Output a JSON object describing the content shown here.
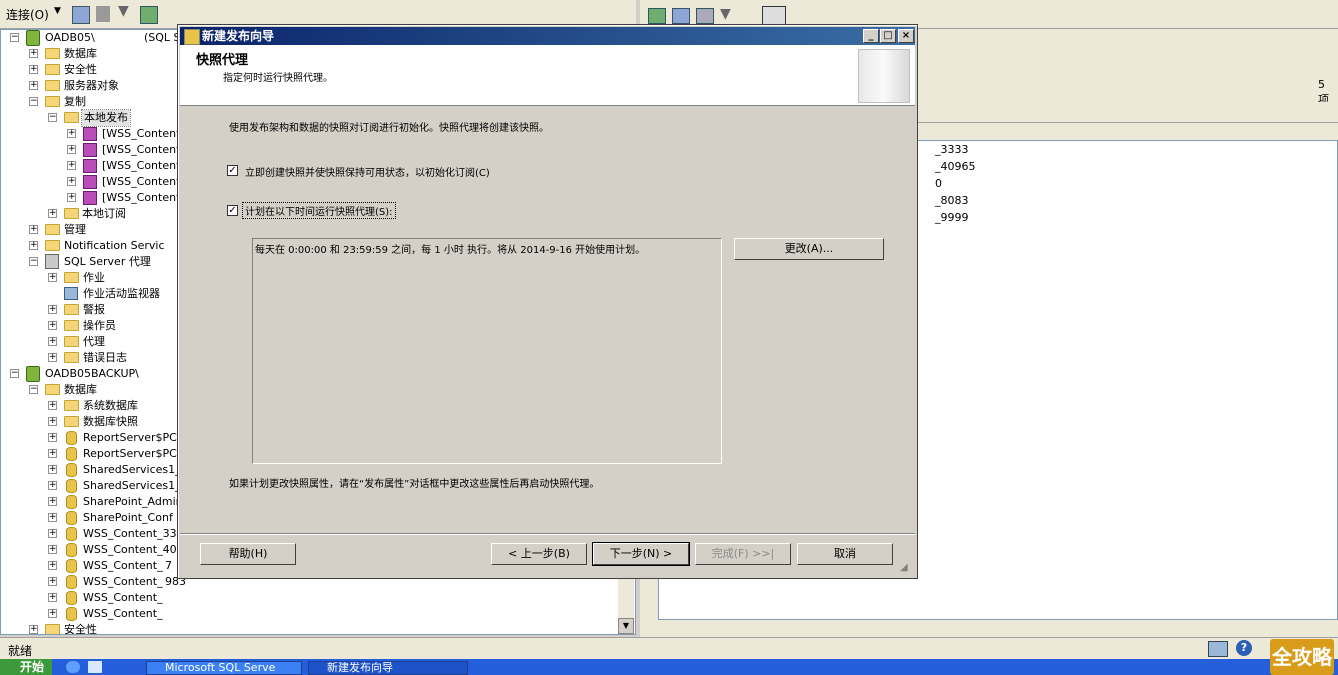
{
  "toolbar": {
    "connect_label": "连接(O)"
  },
  "explorer": {
    "servers": [
      {
        "name": "OADB05\\",
        "suffix": "(SQL S"
      },
      {
        "name": "OADB05BACKUP\\"
      }
    ],
    "nodes": {
      "databases": "数据库",
      "security": "安全性",
      "server_objects": "服务器对象",
      "replication": "复制",
      "local_publications": "本地发布",
      "publications": [
        "[WSS_Content",
        "[WSS_Content",
        "[WSS_Content",
        "[WSS_Content",
        "[WSS_Content"
      ],
      "local_subscriptions": "本地订阅",
      "management": "管理",
      "notification": "Notification Servic",
      "agent": "SQL Server 代理",
      "jobs": "作业",
      "job_monitor": "作业活动监视器",
      "alerts": "警报",
      "operators": "操作员",
      "proxies": "代理",
      "error_logs": "错误日志",
      "databases2": "数据库",
      "system_db": "系统数据库",
      "db_snapshots": "数据库快照",
      "dbs": [
        "ReportServer$PC1",
        "ReportServer$PC1",
        "SharedServices1_",
        "SharedServices1_",
        "SharePoint_Admin",
        "SharePoint_Conf",
        "WSS_Content_3333",
        "WSS_Content_4096",
        "WSS_Content_",
        "WSS_Content_",
        "WSS_Content_",
        "WSS_Content_"
      ],
      "db_extra": [
        "",
        "",
        "",
        "",
        "",
        "",
        "",
        "",
        "7",
        "983",
        "",
        ""
      ],
      "security2": "安全性"
    }
  },
  "rightpane": {
    "count_text": "5 项",
    "items": [
      "_3333",
      "_40965",
      "0",
      "_8083",
      "_9999"
    ]
  },
  "status": {
    "text": "就绪"
  },
  "taskbar": {
    "start": "开始",
    "tasks": [
      "Microsoft SQL Serve",
      "新建发布向导"
    ],
    "watermark": "全攻略"
  },
  "dialog": {
    "title": "新建发布向导",
    "header_title": "快照代理",
    "header_subtitle": "指定何时运行快照代理。",
    "intro": "使用发布架构和数据的快照对订阅进行初始化。快照代理将创建该快照。",
    "checkbox1": {
      "label": "立即创建快照并使快照保持可用状态，以初始化订阅(C)",
      "checked": true
    },
    "checkbox2": {
      "label": "计划在以下时间运行快照代理(S):",
      "checked": true
    },
    "schedule_text": "每天在 0:00:00 和 23:59:59 之间，每 1 小时 执行。将从 2014-9-16 开始使用计划。",
    "change_button": "更改(A)...",
    "footer_note": "如果计划更改快照属性，请在“发布属性”对话框中更改这些属性后再启动快照代理。",
    "buttons": {
      "help": "帮助(H)",
      "back": "< 上一步(B)",
      "next": "下一步(N) >",
      "finish": "完成(F) >>|",
      "cancel": "取消"
    }
  }
}
